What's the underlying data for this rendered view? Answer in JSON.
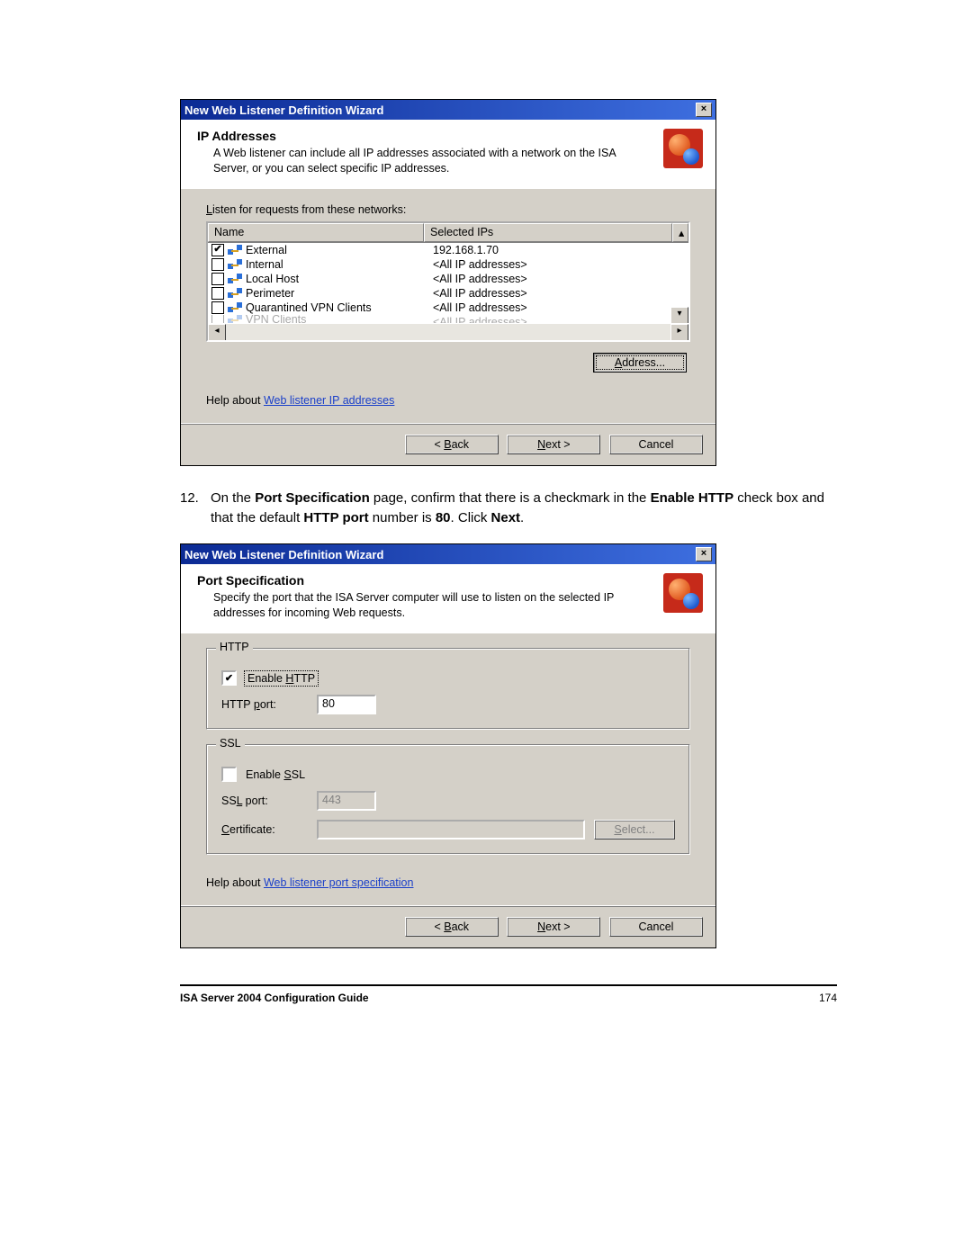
{
  "dialog1": {
    "title": "New Web Listener Definition Wizard",
    "banner_title": "IP Addresses",
    "banner_desc": "A Web listener can include all IP addresses associated with a network on the ISA Server, or you can select specific IP addresses.",
    "listen_label_pre": "L",
    "listen_label_rest": "isten for requests from these networks:",
    "columns": {
      "name": "Name",
      "selected": "Selected IPs"
    },
    "rows": [
      {
        "checked": true,
        "name": "External",
        "ips": "192.168.1.70"
      },
      {
        "checked": false,
        "name": "Internal",
        "ips": "<All IP addresses>"
      },
      {
        "checked": false,
        "name": "Local Host",
        "ips": "<All IP addresses>"
      },
      {
        "checked": false,
        "name": "Perimeter",
        "ips": "<All IP addresses>"
      },
      {
        "checked": false,
        "name": "Quarantined VPN Clients",
        "ips": "<All IP addresses>"
      },
      {
        "checked": false,
        "name": "VPN Clients",
        "ips": "<All IP addresses>"
      }
    ],
    "address_btn_u": "A",
    "address_btn_rest": "ddress...",
    "help_prefix": "Help about ",
    "help_link": "Web listener IP addresses",
    "back_pre": "< ",
    "back_u": "B",
    "back_rest": "ack",
    "next_u": "N",
    "next_rest": "ext >",
    "cancel": "Cancel"
  },
  "step": {
    "num": "12.",
    "l1a": "On the ",
    "l1b": "Port Specification",
    "l1c": " page, confirm that there is a checkmark in the ",
    "l1d": "Enable HTTP",
    "l2a": " check box and that the default ",
    "l2b": "HTTP port",
    "l2c": " number is ",
    "l2d": "80",
    "l2e": ". Click ",
    "l2f": "Next",
    "l2g": "."
  },
  "dialog2": {
    "title": "New Web Listener Definition Wizard",
    "banner_title": "Port Specification",
    "banner_desc": "Specify the port that the ISA Server computer will use to listen on the selected IP addresses for incoming Web requests.",
    "http": {
      "legend": "HTTP",
      "enable_pre": "Enable ",
      "enable_u": "H",
      "enable_rest": "TTP",
      "enable_checked": true,
      "port_label_pre": "HTTP ",
      "port_label_u": "p",
      "port_label_rest": "ort:",
      "port_value": "80"
    },
    "ssl": {
      "legend": "SSL",
      "enable_pre": "Enable ",
      "enable_u": "S",
      "enable_rest": "SL",
      "enable_checked": false,
      "port_label_pre": "SS",
      "port_label_u": "L",
      "port_label_rest": " port:",
      "port_value": "443",
      "cert_u": "C",
      "cert_rest": "ertificate:",
      "select_u": "S",
      "select_rest": "elect..."
    },
    "help_prefix": "Help about ",
    "help_link": "Web listener port specification",
    "back_pre": "< ",
    "back_u": "B",
    "back_rest": "ack",
    "next_u": "N",
    "next_rest": "ext >",
    "cancel": "Cancel"
  },
  "footer": {
    "title": "ISA Server 2004 Configuration Guide",
    "page": "174"
  }
}
